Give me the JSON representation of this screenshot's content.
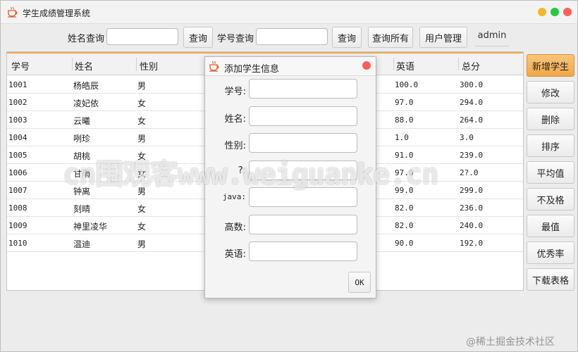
{
  "window": {
    "title": "学生成绩管理系统"
  },
  "toolbar": {
    "name_search_label": "姓名查询",
    "query_btn_1": "查询",
    "id_search_label": "学号查询",
    "query_btn_2": "查询",
    "query_all_btn": "查询所有",
    "user_mgmt_btn": "用户管理",
    "admin_label": "admin"
  },
  "table": {
    "headers": [
      "学号",
      "姓名",
      "性别",
      "英语",
      "总分"
    ],
    "rows": [
      {
        "id": "1001",
        "name": "杨皓辰",
        "gender": "男",
        "english": "100.0",
        "total": "300.0"
      },
      {
        "id": "1002",
        "name": "凌妃依",
        "gender": "女",
        "english": "97.0",
        "total": "294.0"
      },
      {
        "id": "1003",
        "name": "云曦",
        "gender": "女",
        "english": "88.0",
        "total": "264.0"
      },
      {
        "id": "1004",
        "name": "咧珍",
        "gender": "男",
        "english": "1.0",
        "total": "3.0"
      },
      {
        "id": "1005",
        "name": "胡桃",
        "gender": "女",
        "english": "91.0",
        "total": "239.0"
      },
      {
        "id": "1006",
        "name": "甘雨",
        "gender": "女",
        "english": "97.0",
        "total": "2?.0"
      },
      {
        "id": "1007",
        "name": "钟离",
        "gender": "男",
        "english": "99.0",
        "total": "299.0"
      },
      {
        "id": "1008",
        "name": "刻晴",
        "gender": "女",
        "english": "82.0",
        "total": "236.0"
      },
      {
        "id": "1009",
        "name": "神里凌华",
        "gender": "女",
        "english": "82.0",
        "total": "240.0"
      },
      {
        "id": "1010",
        "name": "温迪",
        "gender": "男",
        "english": "90.0",
        "total": "192.0"
      }
    ]
  },
  "sidebar": {
    "buttons": [
      "新增学生",
      "修改",
      "删除",
      "排序",
      "平均值",
      "不及格",
      "最值",
      "优秀率",
      "下载表格"
    ]
  },
  "dialog": {
    "title": "添加学生信息",
    "fields": [
      "学号:",
      "姓名:",
      "性别:",
      "?:",
      "java:",
      "高数:",
      "英语:"
    ],
    "ok": "OK"
  },
  "overlay": {
    "watermark": "cn围观客www.weiguanke.cn",
    "credit": "@稀土掘金技术社区"
  },
  "colors": {
    "accent_orange": "#f0a848",
    "close_red": "#ff5f57",
    "min_yellow": "#f5b62a",
    "max_green": "#28c840"
  }
}
